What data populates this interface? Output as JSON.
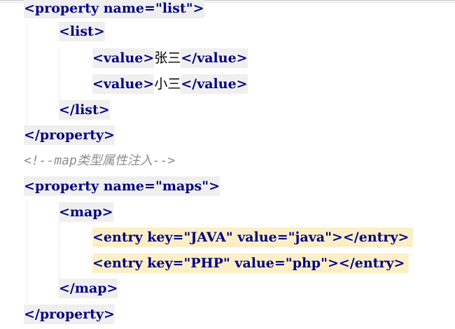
{
  "editor": {
    "lines": [
      {
        "text_parts": [
          "<property name=\"list\">"
        ]
      },
      {
        "text_parts": [
          "<list>"
        ]
      },
      {
        "text_parts": [
          "<value>",
          "张三",
          "</value>"
        ]
      },
      {
        "text_parts": [
          "<value>",
          "小三",
          "</value>"
        ]
      },
      {
        "text_parts": [
          "</list>"
        ]
      },
      {
        "text_parts": [
          "</property>"
        ]
      },
      {
        "text_parts": [
          "<!--map类型属性注入-->"
        ]
      },
      {
        "text_parts": [
          "<property name=\"maps\">"
        ]
      },
      {
        "text_parts": [
          "<map>"
        ]
      },
      {
        "text_parts": [
          "<entry key=\"JAVA\" value=\"java\"></entry>"
        ]
      },
      {
        "text_parts": [
          "<entry key=\"PHP\" value=\"php\"></entry>"
        ]
      },
      {
        "text_parts": [
          "</map>"
        ]
      },
      {
        "text_parts": [
          "</property>"
        ]
      }
    ],
    "colors": {
      "tag": "#000080",
      "attribute": "#0000ff",
      "string": "#008000",
      "comment": "#8c8c8c",
      "tag_background": "#efefef",
      "highlight_background": "#fcefc7"
    }
  }
}
